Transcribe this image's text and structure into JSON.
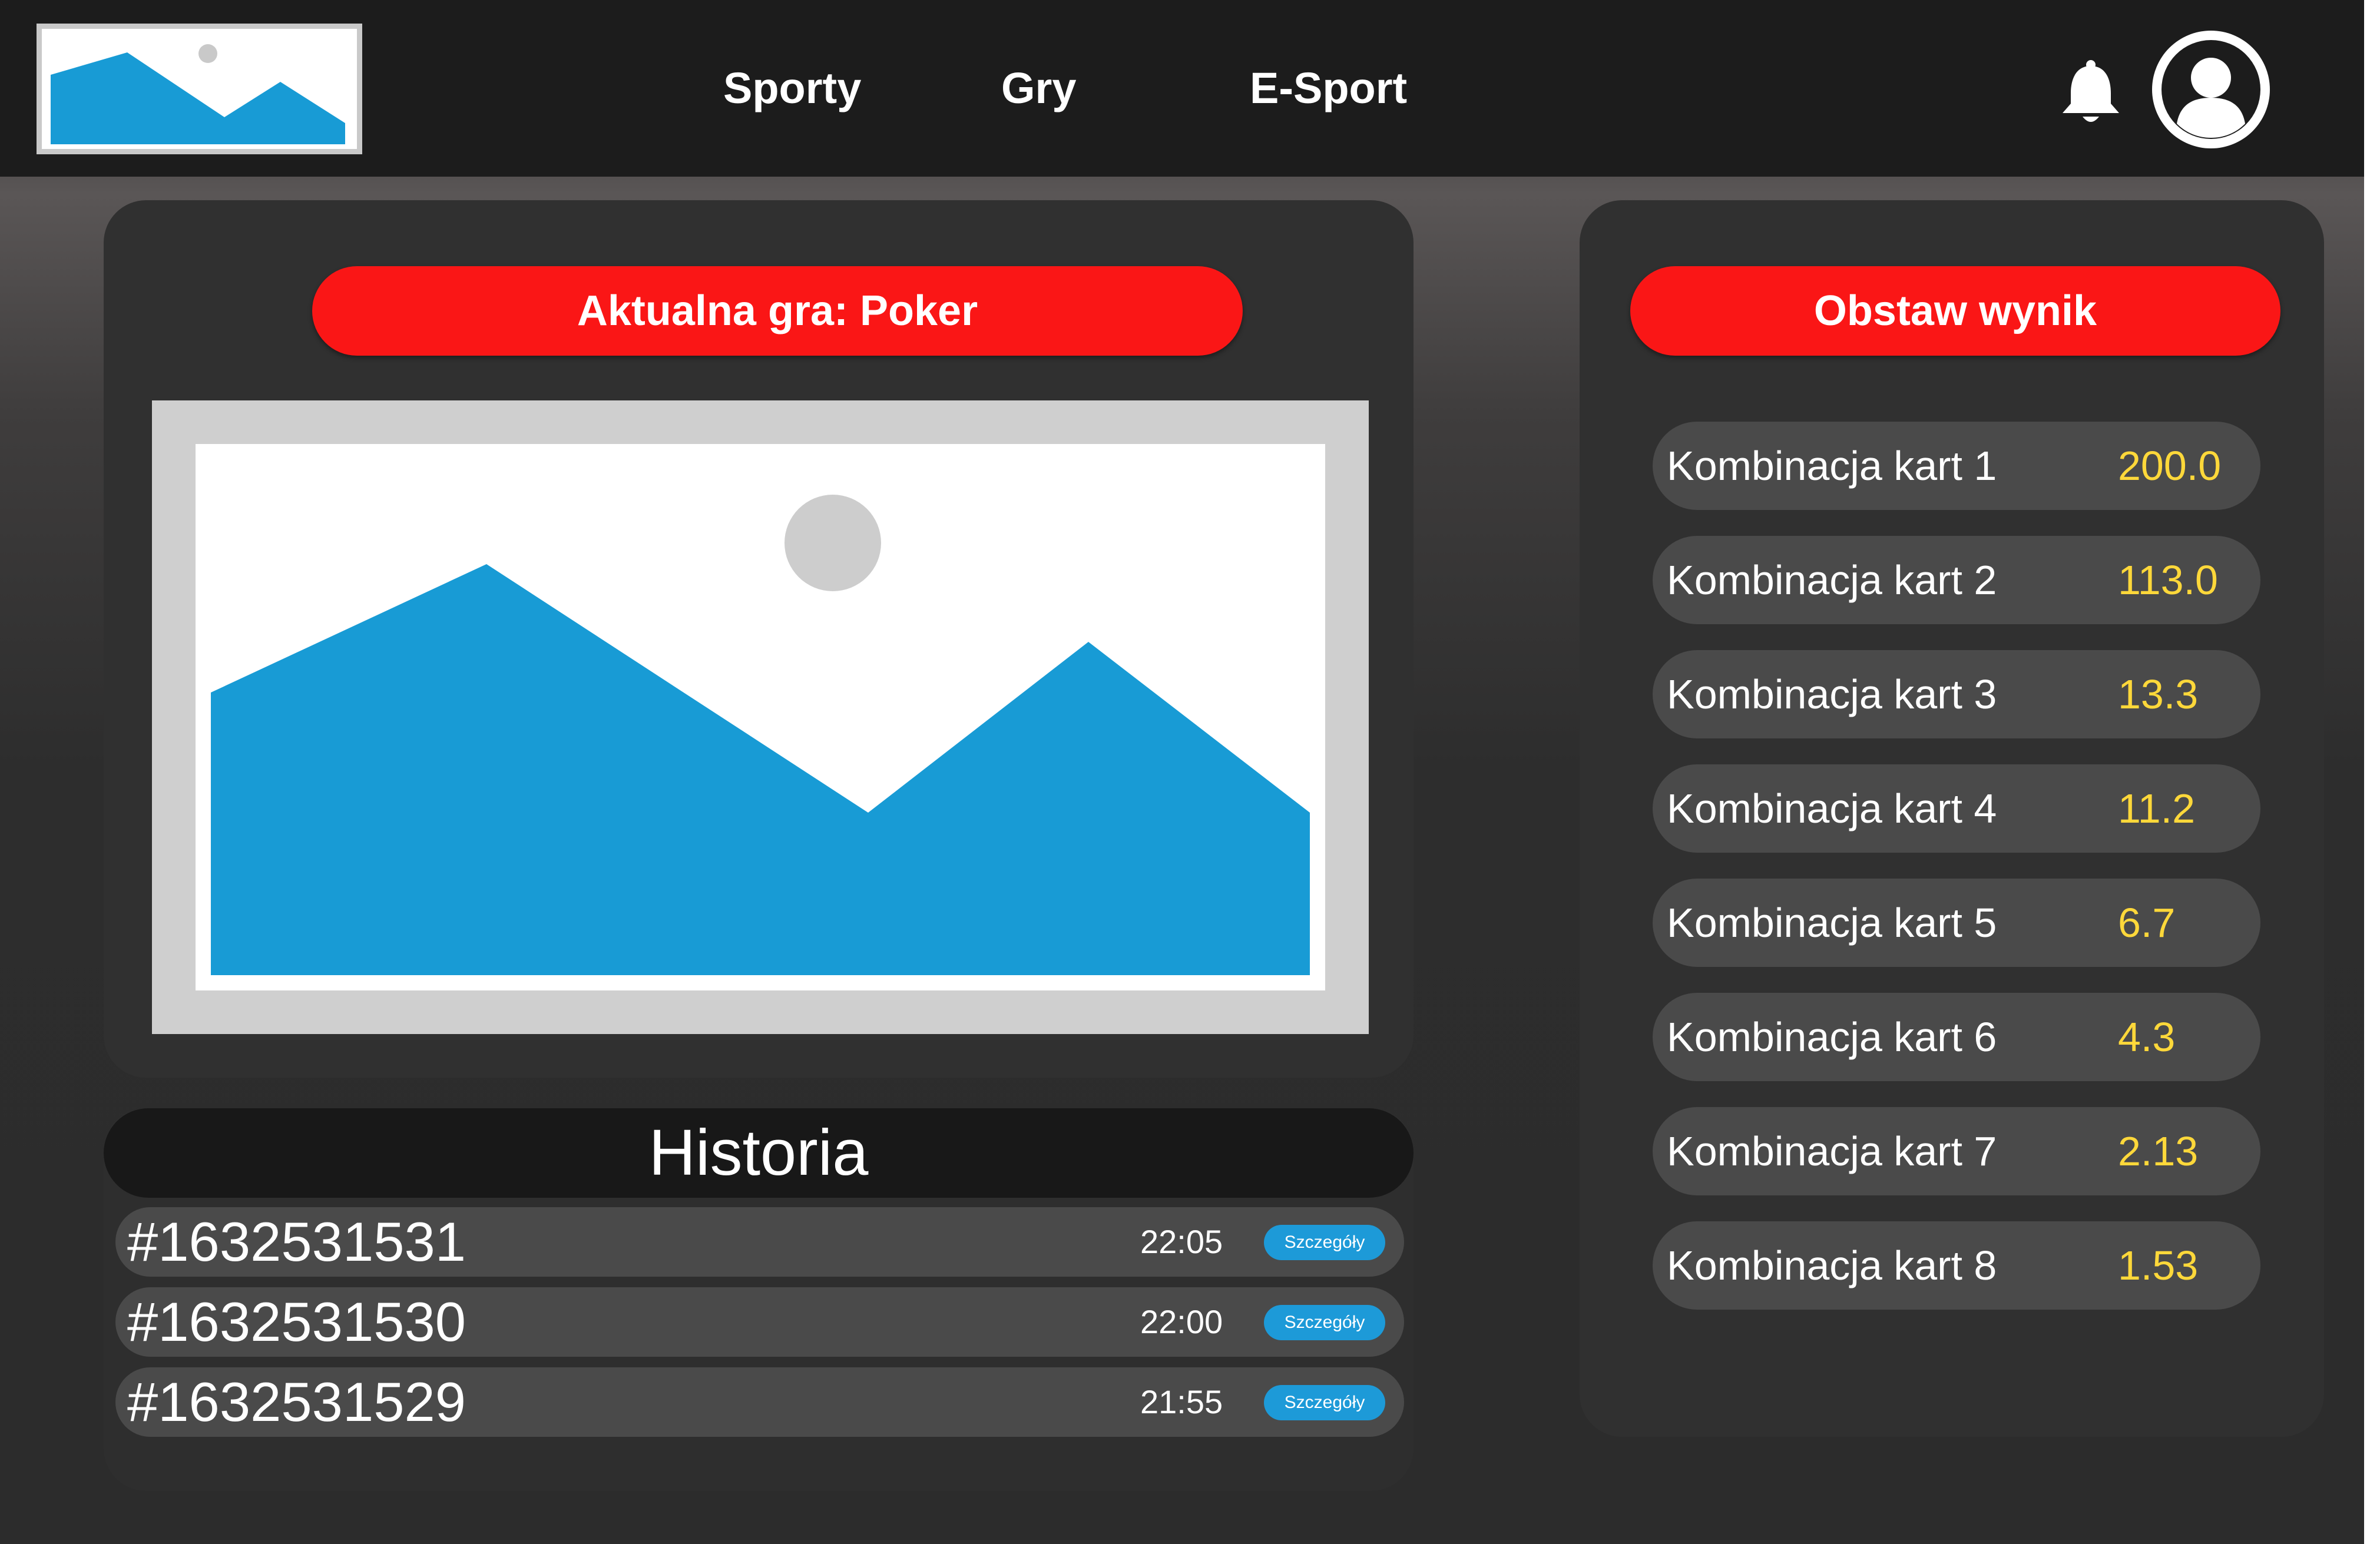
{
  "nav": {
    "logo": "logo-image-placeholder",
    "items": [
      {
        "label": "Sporty"
      },
      {
        "label": "Gry"
      },
      {
        "label": "E-Sport"
      }
    ],
    "icons": {
      "notifications": "bell-icon",
      "profile": "user-avatar-icon"
    }
  },
  "game": {
    "title": "Aktualna gra: Poker",
    "image": "game-image-placeholder"
  },
  "bet": {
    "title": "Obstaw wynik",
    "rows": [
      {
        "label": "Kombinacja kart 1",
        "odds": "200.0"
      },
      {
        "label": "Kombinacja kart 2",
        "odds": "113.0"
      },
      {
        "label": "Kombinacja kart 3",
        "odds": "13.3"
      },
      {
        "label": "Kombinacja kart 4",
        "odds": "11.2"
      },
      {
        "label": "Kombinacja kart 5",
        "odds": "6.7"
      },
      {
        "label": "Kombinacja kart 6",
        "odds": "4.3"
      },
      {
        "label": "Kombinacja kart 7",
        "odds": "2.13"
      },
      {
        "label": "Kombinacja kart 8",
        "odds": "1.53"
      }
    ]
  },
  "history": {
    "title": "Historia",
    "rows": [
      {
        "id": "#1632531531",
        "time": "22:05",
        "button": "Szczegóły"
      },
      {
        "id": "#1632531530",
        "time": "22:00",
        "button": "Szczegóły"
      },
      {
        "id": "#1632531529",
        "time": "21:55",
        "button": "Szczegóły"
      }
    ]
  },
  "colors": {
    "accent_red": "#fa1616",
    "odds_yellow": "#ffd83a",
    "button_blue": "#1d9ad8",
    "image_blue": "#189bd5"
  }
}
